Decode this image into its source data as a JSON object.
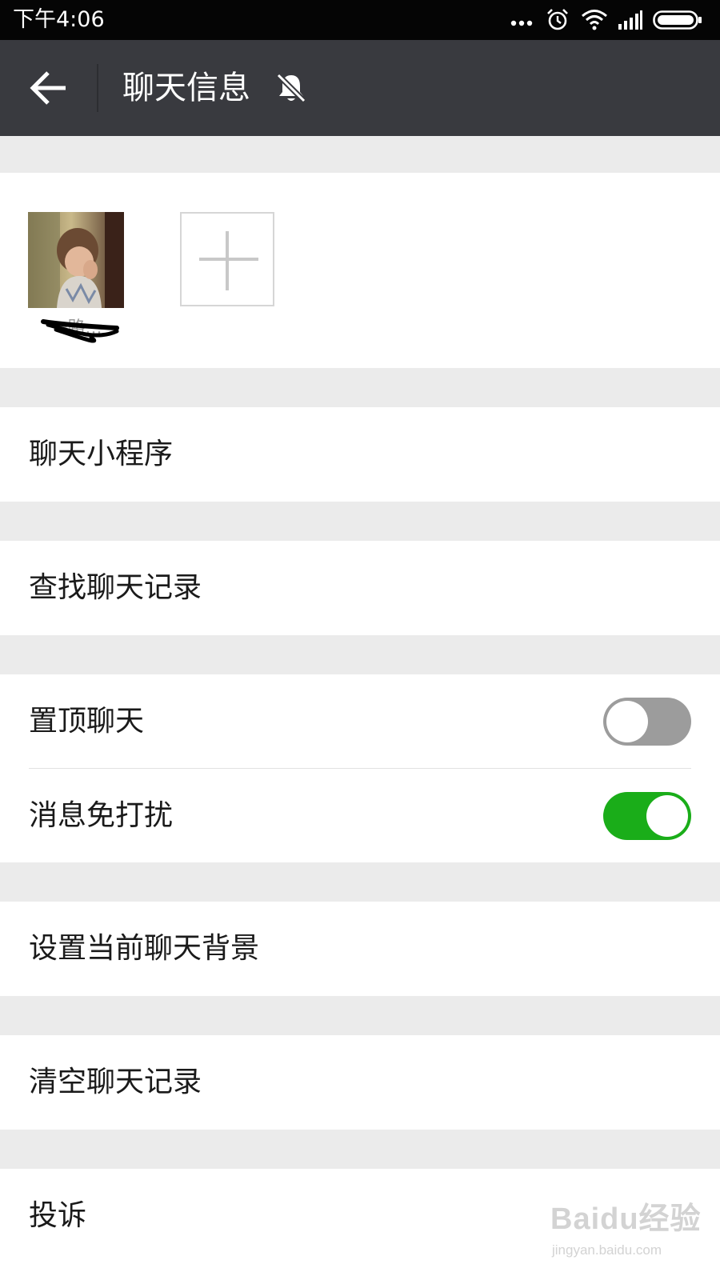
{
  "status_bar": {
    "time": "下午4:06",
    "icons": [
      "more-dots-icon",
      "alarm-icon",
      "wifi-icon",
      "signal-icon",
      "battery-icon"
    ]
  },
  "title_bar": {
    "title": "聊天信息",
    "back_icon": "arrow-left-icon",
    "mute_icon": "bell-off-icon"
  },
  "members": {
    "member_name": "一路...",
    "add_icon": "plus-icon"
  },
  "rows": {
    "mini_programs": "聊天小程序",
    "search_history": "查找聊天记录",
    "pin_chat": "置顶聊天",
    "do_not_disturb": "消息免打扰",
    "set_background": "设置当前聊天背景",
    "clear_history": "清空聊天记录",
    "report": "投诉"
  },
  "toggles": {
    "pin_chat": false,
    "do_not_disturb": true
  },
  "colors": {
    "title_bar_bg": "#393a3f",
    "toggle_on": "#1aad19",
    "toggle_off": "#9c9c9c",
    "page_bg": "#ebebeb"
  },
  "watermark": {
    "main": "Baidu经验",
    "sub": "jingyan.baidu.com"
  }
}
